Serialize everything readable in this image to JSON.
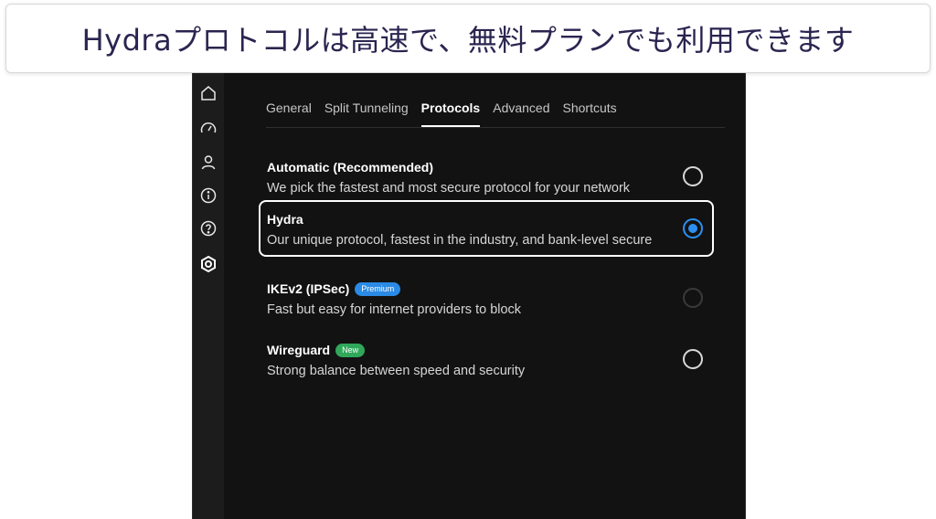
{
  "caption": {
    "text": "Hydraプロトコルは高速で、無料プランでも利用できます"
  },
  "sidebar": {
    "icons": [
      "home-icon",
      "speedometer-icon",
      "user-icon",
      "info-icon",
      "help-icon",
      "settings-icon"
    ]
  },
  "tabs": [
    {
      "label": "General"
    },
    {
      "label": "Split Tunneling"
    },
    {
      "label": "Protocols"
    },
    {
      "label": "Advanced"
    },
    {
      "label": "Shortcuts"
    }
  ],
  "active_tab": "Protocols",
  "protocols": [
    {
      "title": "Automatic (Recommended)",
      "description": "We pick the fastest and most secure protocol for your network",
      "badge": "",
      "state": "unselected"
    },
    {
      "title": "Hydra",
      "description": "Our unique protocol, fastest in the industry, and bank-level secure",
      "badge": "",
      "state": "selected"
    },
    {
      "title": "IKEv2 (IPSec)",
      "description": "Fast but easy for internet providers to block",
      "badge": "Premium",
      "state": "disabled"
    },
    {
      "title": "Wireguard",
      "description": "Strong balance between speed and security",
      "badge": "New",
      "state": "unselected"
    }
  ],
  "colors": {
    "accent": "#2d8ff0",
    "premium_badge": "#2a8ae6",
    "new_badge": "#2fa85a",
    "app_background": "#121212",
    "caption_text": "#2a2550"
  }
}
